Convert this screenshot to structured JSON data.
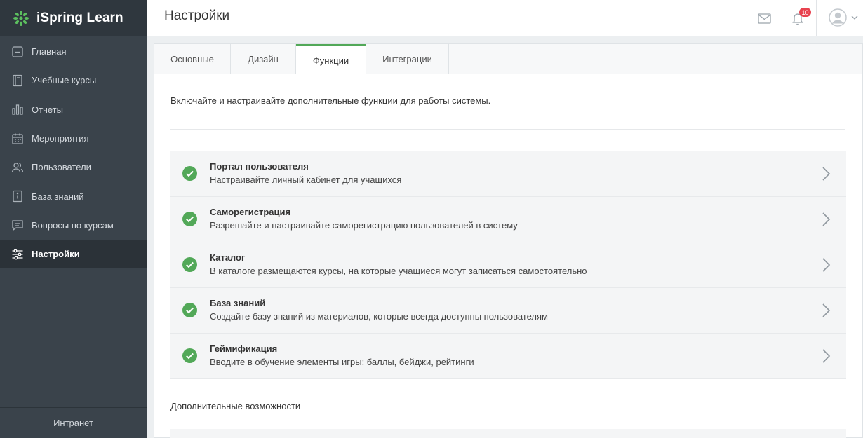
{
  "app": {
    "name": "iSpring Learn"
  },
  "sidebar": {
    "items": [
      {
        "label": "Главная",
        "icon": "home-icon"
      },
      {
        "label": "Учебные курсы",
        "icon": "book-icon"
      },
      {
        "label": "Отчеты",
        "icon": "bar-chart-icon"
      },
      {
        "label": "Мероприятия",
        "icon": "calendar-icon"
      },
      {
        "label": "Пользователи",
        "icon": "users-icon"
      },
      {
        "label": "База знаний",
        "icon": "knowledge-icon"
      },
      {
        "label": "Вопросы по курсам",
        "icon": "chat-icon"
      },
      {
        "label": "Настройки",
        "icon": "sliders-icon",
        "active": true
      }
    ],
    "footer": "Интранет"
  },
  "header": {
    "title": "Настройки",
    "notifications_count": "10"
  },
  "tabs": [
    {
      "label": "Основные"
    },
    {
      "label": "Дизайн"
    },
    {
      "label": "Функции",
      "active": true
    },
    {
      "label": "Интеграции"
    }
  ],
  "main": {
    "intro": "Включайте и настраивайте дополнительные функции для работы системы.",
    "features": [
      {
        "title": "Портал пользователя",
        "desc": "Настраивайте личный кабинет для учащихся"
      },
      {
        "title": "Саморегистрация",
        "desc": "Разрешайте и настраивайте саморегистрацию пользователей в систему"
      },
      {
        "title": "Каталог",
        "desc": "В каталоге размещаются курсы, на которые учащиеся могут записаться самостоятельно"
      },
      {
        "title": "База знаний",
        "desc": "Создайте базу знаний из материалов, которые всегда доступны пользователям"
      },
      {
        "title": "Геймификация",
        "desc": "Вводите в обучение элементы игры: баллы, бейджи, рейтинги"
      }
    ],
    "extra_title": "Дополнительные возможности"
  },
  "colors": {
    "accent_green": "#52a858",
    "sidebar_bg": "#3a434b",
    "badge_red": "#e8424f"
  }
}
